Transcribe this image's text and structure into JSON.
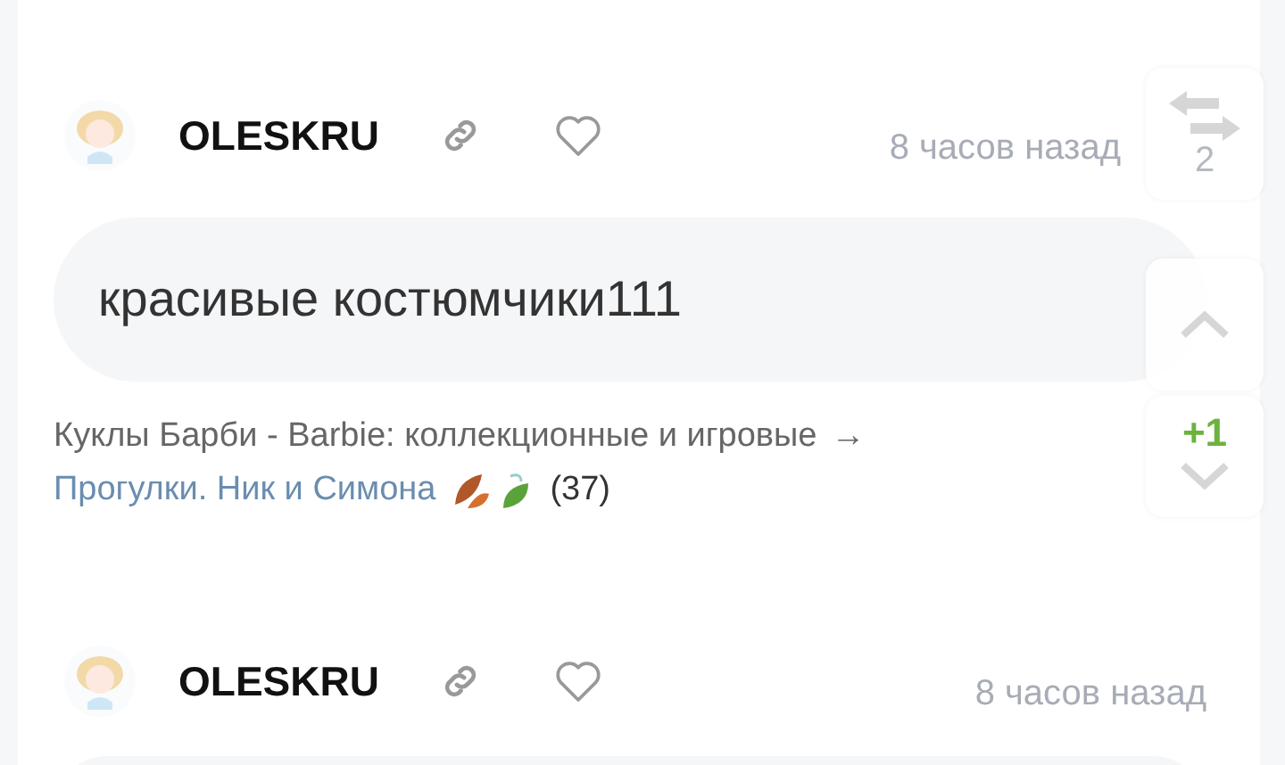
{
  "comments": [
    {
      "author": "OLESKRU",
      "time": "8 часов назад",
      "text": "красивые костюмчики111",
      "path": "Куклы Барби - Barbie: коллекционные и игровые",
      "arrow": "→",
      "topic": "Прогулки. Ник и Симона",
      "count": "(37)"
    },
    {
      "author": "OLESKRU",
      "time": "8 часов назад"
    }
  ],
  "side_buttons": [
    {
      "kind": "swap",
      "label": "2"
    },
    {
      "kind": "up"
    },
    {
      "kind": "down",
      "badge": "+1"
    }
  ]
}
